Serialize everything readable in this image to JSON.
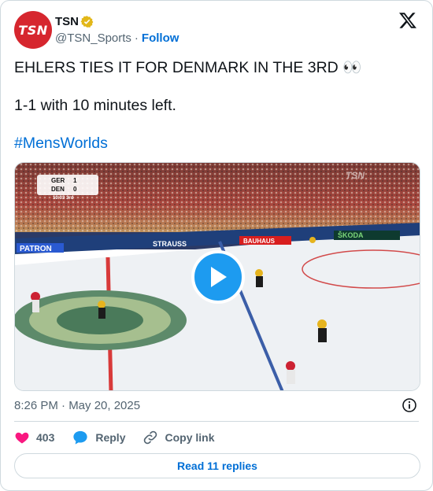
{
  "author": {
    "name": "TSN",
    "handle": "@TSN_Sports",
    "follow_label": "Follow",
    "avatar_text": "TSN",
    "separator": "·"
  },
  "tweet": {
    "line1": "EHLERS TIES IT FOR DENMARK IN THE 3RD 👀",
    "line2": "1-1 with 10 minutes left.",
    "hashtag": "#MensWorlds"
  },
  "video": {
    "scoreboard": {
      "team1": "GER",
      "score1": "1",
      "team2": "DEN",
      "score2": "0",
      "clock": "10:03",
      "period": "3rd"
    },
    "board_ads": [
      "PATRON",
      "STRAUSS",
      "BAUHAUS",
      "ŠKODA"
    ],
    "broadcaster_mark": "TSN"
  },
  "timestamp": "8:26 PM · May 20, 2025",
  "actions": {
    "likes": "403",
    "reply_label": "Reply",
    "copy_link_label": "Copy link"
  },
  "read_replies_label": "Read 11 replies",
  "colors": {
    "accent": "#1d9bf0",
    "link": "#006fd6",
    "like": "#f91880",
    "brand_red": "#d6262e"
  }
}
